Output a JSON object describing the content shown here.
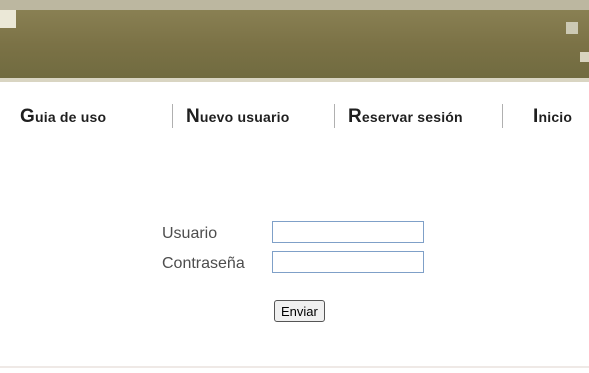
{
  "banner": {
    "color": "#7b7246"
  },
  "nav": {
    "items": [
      {
        "first": "G",
        "rest": "uia de uso"
      },
      {
        "first": "N",
        "rest": "uevo usuario"
      },
      {
        "first": "R",
        "rest": "eservar sesión"
      },
      {
        "first": "I",
        "rest": "nicio"
      }
    ]
  },
  "login": {
    "user_label": "Usuario",
    "password_label": "Contraseña",
    "user_value": "",
    "password_value": "",
    "submit_label": "Enviar"
  }
}
